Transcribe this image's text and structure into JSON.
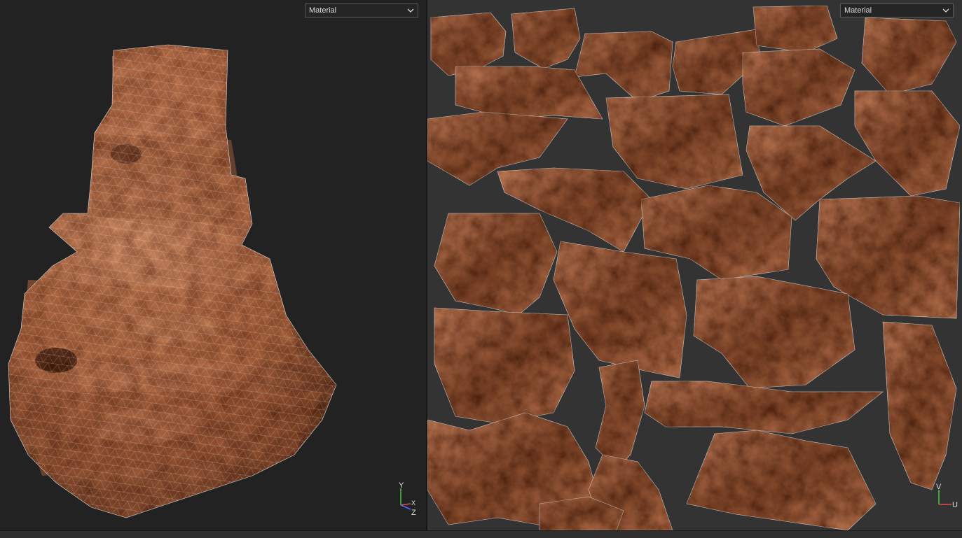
{
  "viewport_3d": {
    "shading_dropdown": {
      "value": "Material"
    },
    "axis_gizmo": {
      "y": "Y",
      "x": "X",
      "z": "Z"
    }
  },
  "viewport_uv": {
    "shading_dropdown": {
      "value": "Material"
    },
    "axis_gizmo": {
      "v": "V",
      "u": "U"
    }
  },
  "colors": {
    "rock_light": "#c9825c",
    "rock_dark": "#6a3a22",
    "wire": "#e8e8e8",
    "uv_background": "#333333",
    "viewport_background": "#222222"
  }
}
